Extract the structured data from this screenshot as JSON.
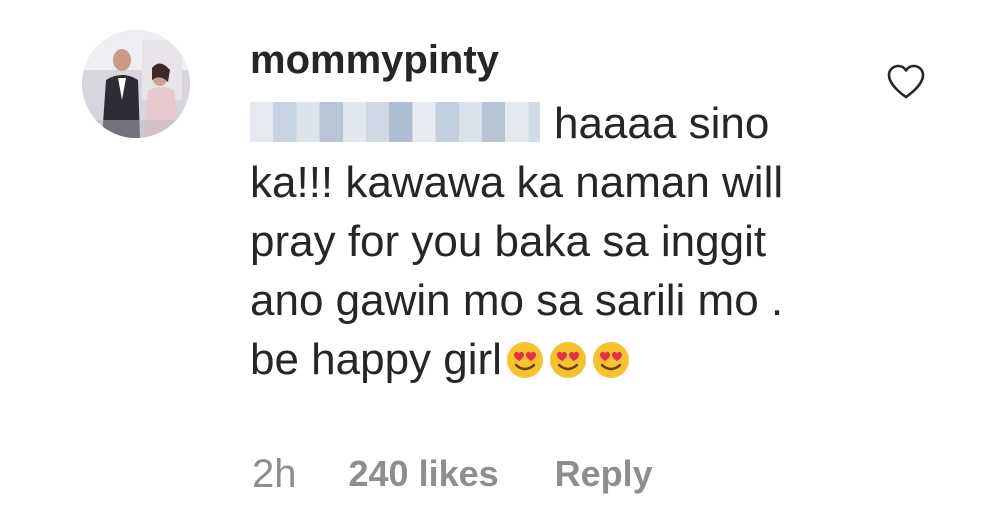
{
  "comment": {
    "username": "mommypinty",
    "text": "haaaa sino ka!!! kawawa ka naman will pray for you baka sa inggit ano gawin mo sa sarili mo . be happy girl",
    "emojis": [
      "heart-eyes-emoji",
      "heart-eyes-emoji",
      "heart-eyes-emoji"
    ],
    "time": "2h",
    "likes": "240 likes",
    "reply_label": "Reply"
  },
  "icons": {
    "like": "heart-outline-icon"
  },
  "colors": {
    "text": "#262626",
    "meta": "#8e8e8e",
    "emoji_face": "#f7c22b",
    "emoji_hearts": "#e2304b"
  }
}
